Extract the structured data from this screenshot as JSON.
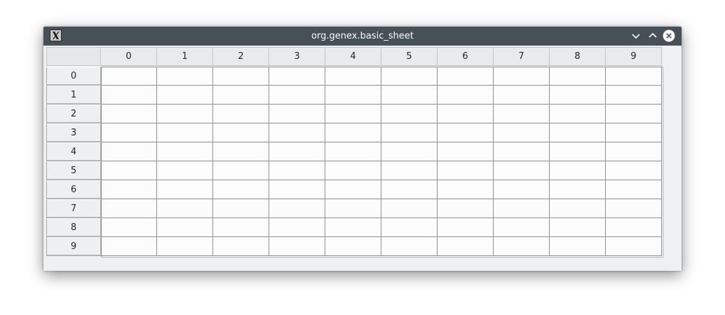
{
  "window": {
    "title": "org.genex.basic_sheet",
    "icons": {
      "app": "x-app-icon",
      "minimize": "chevron-down-icon",
      "maximize": "chevron-up-icon",
      "close": "close-icon"
    }
  },
  "sheet": {
    "column_headers": [
      "0",
      "1",
      "2",
      "3",
      "4",
      "5",
      "6",
      "7",
      "8",
      "9"
    ],
    "row_headers": [
      "0",
      "1",
      "2",
      "3",
      "4",
      "5",
      "6",
      "7",
      "8",
      "9"
    ]
  }
}
